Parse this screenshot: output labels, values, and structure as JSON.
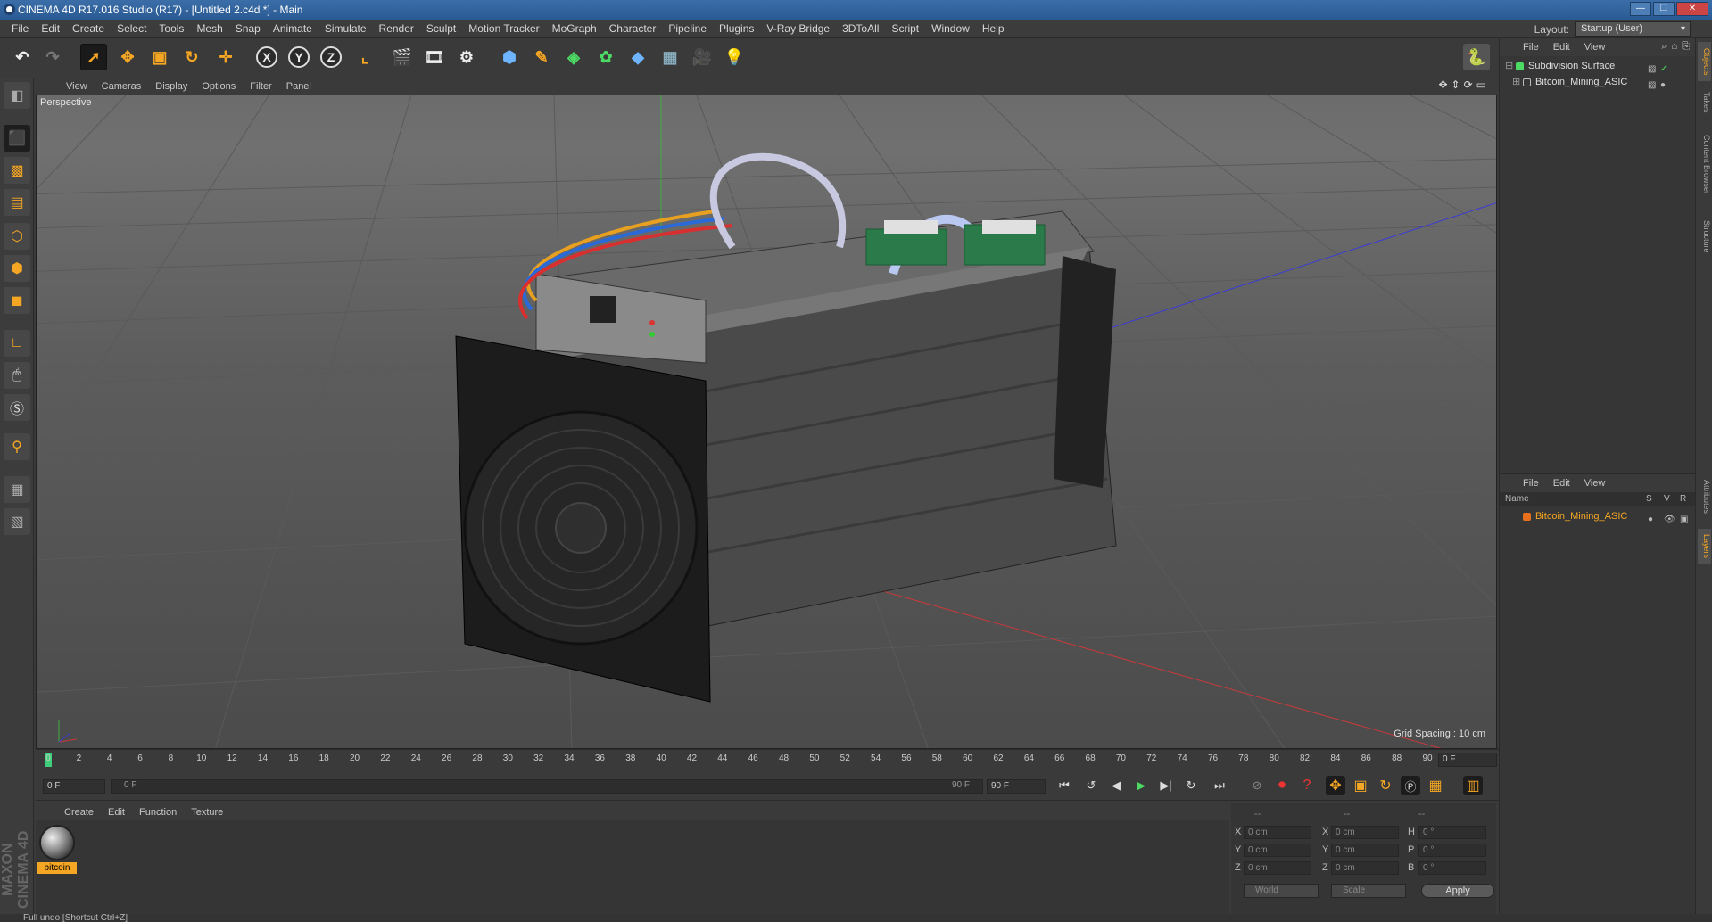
{
  "window": {
    "title": "CINEMA 4D R17.016 Studio (R17) - [Untitled 2.c4d *] - Main",
    "controls": [
      "—",
      "❐",
      "✕"
    ]
  },
  "menubar": {
    "items": [
      "File",
      "Edit",
      "Create",
      "Select",
      "Tools",
      "Mesh",
      "Snap",
      "Animate",
      "Simulate",
      "Render",
      "Sculpt",
      "Motion Tracker",
      "MoGraph",
      "Character",
      "Pipeline",
      "Plugins",
      "V-Ray Bridge",
      "3DToAll",
      "Script",
      "Window",
      "Help"
    ],
    "layout_label": "Layout:",
    "layout_value": "Startup (User)"
  },
  "toolbar": {
    "axis_x": "X",
    "axis_y": "Y",
    "axis_z": "Z"
  },
  "viewport": {
    "menu": [
      "View",
      "Cameras",
      "Display",
      "Options",
      "Filter",
      "Panel"
    ],
    "camera_label": "Perspective",
    "grid_spacing": "Grid Spacing : 10 cm"
  },
  "timeline": {
    "ticks": [
      "0",
      "2",
      "4",
      "6",
      "8",
      "10",
      "12",
      "14",
      "16",
      "18",
      "20",
      "22",
      "24",
      "26",
      "28",
      "30",
      "32",
      "34",
      "36",
      "38",
      "40",
      "42",
      "44",
      "46",
      "48",
      "50",
      "52",
      "54",
      "56",
      "58",
      "60",
      "62",
      "64",
      "66",
      "68",
      "70",
      "72",
      "74",
      "76",
      "78",
      "80",
      "82",
      "84",
      "86",
      "88",
      "90"
    ],
    "current_frame": "0 F"
  },
  "transport": {
    "start_field": "0 F",
    "range_start": "0 F",
    "range_end": "90 F",
    "end_field": "90 F"
  },
  "material_panel": {
    "menu": [
      "Create",
      "Edit",
      "Function",
      "Texture"
    ],
    "material_name": "bitcoin"
  },
  "coordinates": {
    "header": [
      "--",
      "--",
      "--"
    ],
    "rows": [
      {
        "l1": "X",
        "v1": "0 cm",
        "l2": "X",
        "v2": "0 cm",
        "l3": "H",
        "v3": "0 °"
      },
      {
        "l1": "Y",
        "v1": "0 cm",
        "l2": "Y",
        "v2": "0 cm",
        "l3": "P",
        "v3": "0 °"
      },
      {
        "l1": "Z",
        "v1": "0 cm",
        "l2": "Z",
        "v2": "0 cm",
        "l3": "B",
        "v3": "0 °"
      }
    ],
    "mode_world": "World",
    "mode_scale": "Scale",
    "apply": "Apply"
  },
  "object_manager": {
    "menu": [
      "File",
      "Edit",
      "View"
    ],
    "objects": [
      {
        "name": "Subdivision Surface",
        "color": "#4cd964"
      },
      {
        "name": "Bitcoin_Mining_ASIC",
        "color": "#bbbbbb"
      }
    ]
  },
  "layer_manager": {
    "menu": [
      "File",
      "Edit",
      "View"
    ],
    "columns": {
      "name": "Name",
      "s": "S",
      "v": "V",
      "r": "R"
    },
    "layers": [
      {
        "name": "Bitcoin_Mining_ASIC",
        "color": "#e86f1c"
      }
    ]
  },
  "right_tabs": [
    "Objects",
    "Takes",
    "Content Browser",
    "Structure",
    "Attributes",
    "Layers"
  ],
  "brand": "MAXON CINEMA 4D",
  "status": "Full undo [Shortcut Ctrl+Z]"
}
